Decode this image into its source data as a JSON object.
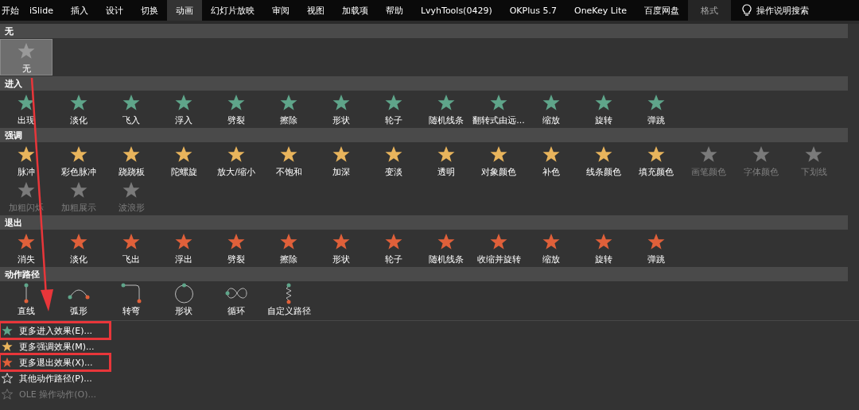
{
  "tabs": [
    {
      "label": "开始",
      "selected": false,
      "contextual": false
    },
    {
      "label": "iSlide",
      "selected": false,
      "contextual": false
    },
    {
      "label": "插入",
      "selected": false,
      "contextual": false
    },
    {
      "label": "设计",
      "selected": false,
      "contextual": false
    },
    {
      "label": "切换",
      "selected": false,
      "contextual": false
    },
    {
      "label": "动画",
      "selected": true,
      "contextual": false
    },
    {
      "label": "幻灯片放映",
      "selected": false,
      "contextual": false
    },
    {
      "label": "审阅",
      "selected": false,
      "contextual": false
    },
    {
      "label": "视图",
      "selected": false,
      "contextual": false
    },
    {
      "label": "加载项",
      "selected": false,
      "contextual": false
    },
    {
      "label": "帮助",
      "selected": false,
      "contextual": false
    },
    {
      "label": "LvyhTools(0429)",
      "selected": false,
      "contextual": false
    },
    {
      "label": "OKPlus 5.7",
      "selected": false,
      "contextual": false
    },
    {
      "label": "OneKey Lite",
      "selected": false,
      "contextual": false
    },
    {
      "label": "百度网盘",
      "selected": false,
      "contextual": false
    },
    {
      "label": "格式",
      "selected": false,
      "contextual": true
    }
  ],
  "search": {
    "label": "操作说明搜索"
  },
  "sections": [
    {
      "title": "无",
      "kind": "none",
      "items": [
        {
          "label": "无",
          "selected": true,
          "disabled": false
        }
      ]
    },
    {
      "title": "进入",
      "kind": "entrance",
      "items": [
        {
          "label": "出现",
          "selected": false,
          "disabled": false
        },
        {
          "label": "淡化",
          "selected": false,
          "disabled": false
        },
        {
          "label": "飞入",
          "selected": false,
          "disabled": false
        },
        {
          "label": "浮入",
          "selected": false,
          "disabled": false
        },
        {
          "label": "劈裂",
          "selected": false,
          "disabled": false
        },
        {
          "label": "擦除",
          "selected": false,
          "disabled": false
        },
        {
          "label": "形状",
          "selected": false,
          "disabled": false
        },
        {
          "label": "轮子",
          "selected": false,
          "disabled": false
        },
        {
          "label": "随机线条",
          "selected": false,
          "disabled": false
        },
        {
          "label": "翻转式由远...",
          "selected": false,
          "disabled": false
        },
        {
          "label": "缩放",
          "selected": false,
          "disabled": false
        },
        {
          "label": "旋转",
          "selected": false,
          "disabled": false
        },
        {
          "label": "弹跳",
          "selected": false,
          "disabled": false
        }
      ]
    },
    {
      "title": "强调",
      "kind": "emphasis",
      "items": [
        {
          "label": "脉冲",
          "selected": false,
          "disabled": false
        },
        {
          "label": "彩色脉冲",
          "selected": false,
          "disabled": false
        },
        {
          "label": "跷跷板",
          "selected": false,
          "disabled": false
        },
        {
          "label": "陀螺旋",
          "selected": false,
          "disabled": false
        },
        {
          "label": "放大/缩小",
          "selected": false,
          "disabled": false
        },
        {
          "label": "不饱和",
          "selected": false,
          "disabled": false
        },
        {
          "label": "加深",
          "selected": false,
          "disabled": false
        },
        {
          "label": "变淡",
          "selected": false,
          "disabled": false
        },
        {
          "label": "透明",
          "selected": false,
          "disabled": false
        },
        {
          "label": "对象颜色",
          "selected": false,
          "disabled": false
        },
        {
          "label": "补色",
          "selected": false,
          "disabled": false
        },
        {
          "label": "线条颜色",
          "selected": false,
          "disabled": false
        },
        {
          "label": "填充颜色",
          "selected": false,
          "disabled": false
        },
        {
          "label": "画笔颜色",
          "selected": false,
          "disabled": true
        },
        {
          "label": "字体颜色",
          "selected": false,
          "disabled": true
        },
        {
          "label": "下划线",
          "selected": false,
          "disabled": true
        },
        {
          "label": "加粗闪烁",
          "selected": false,
          "disabled": true
        },
        {
          "label": "加粗展示",
          "selected": false,
          "disabled": true
        },
        {
          "label": "波浪形",
          "selected": false,
          "disabled": true
        }
      ]
    },
    {
      "title": "退出",
      "kind": "exit",
      "items": [
        {
          "label": "消失",
          "selected": false,
          "disabled": false
        },
        {
          "label": "淡化",
          "selected": false,
          "disabled": false
        },
        {
          "label": "飞出",
          "selected": false,
          "disabled": false
        },
        {
          "label": "浮出",
          "selected": false,
          "disabled": false
        },
        {
          "label": "劈裂",
          "selected": false,
          "disabled": false
        },
        {
          "label": "擦除",
          "selected": false,
          "disabled": false
        },
        {
          "label": "形状",
          "selected": false,
          "disabled": false
        },
        {
          "label": "轮子",
          "selected": false,
          "disabled": false
        },
        {
          "label": "随机线条",
          "selected": false,
          "disabled": false
        },
        {
          "label": "收缩并旋转",
          "selected": false,
          "disabled": false
        },
        {
          "label": "缩放",
          "selected": false,
          "disabled": false
        },
        {
          "label": "旋转",
          "selected": false,
          "disabled": false
        },
        {
          "label": "弹跳",
          "selected": false,
          "disabled": false
        }
      ]
    },
    {
      "title": "动作路径",
      "kind": "path",
      "items": [
        {
          "label": "直线",
          "selected": false,
          "disabled": false,
          "kind": "line"
        },
        {
          "label": "弧形",
          "selected": false,
          "disabled": false,
          "kind": "arc"
        },
        {
          "label": "转弯",
          "selected": false,
          "disabled": false,
          "kind": "turn"
        },
        {
          "label": "形状",
          "selected": false,
          "disabled": false,
          "kind": "circle"
        },
        {
          "label": "循环",
          "selected": false,
          "disabled": false,
          "kind": "loop"
        },
        {
          "label": "自定义路径",
          "selected": false,
          "disabled": false,
          "kind": "custom"
        }
      ]
    }
  ],
  "menu": [
    {
      "label": "更多进入效果(E)...",
      "kind": "entrance",
      "disabled": false,
      "highlighted": true
    },
    {
      "label": "更多强调效果(M)...",
      "kind": "emphasis",
      "disabled": false,
      "highlighted": false
    },
    {
      "label": "更多退出效果(X)...",
      "kind": "exit",
      "disabled": false,
      "highlighted": true
    },
    {
      "label": "其他动作路径(P)...",
      "kind": "outline",
      "disabled": false,
      "highlighted": false
    },
    {
      "label": "OLE 操作动作(O)...",
      "kind": "ole",
      "disabled": true,
      "highlighted": false
    }
  ],
  "annotations": [
    {
      "kind": "arrow"
    }
  ]
}
